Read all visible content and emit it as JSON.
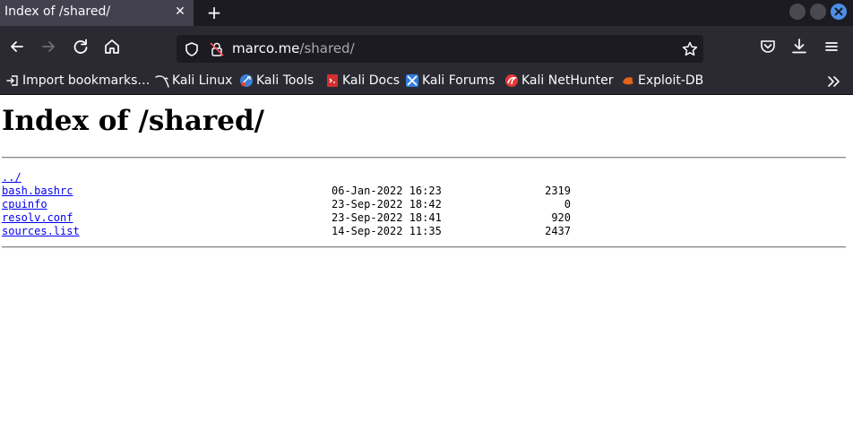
{
  "browser": {
    "tab_title": "Index of /shared/",
    "tab_close": "✕",
    "new_tab": "+",
    "url_host": "marco.me",
    "url_path": "/shared/"
  },
  "bookmarks": [
    {
      "label": "Import bookmarks…",
      "icon": "import-icon"
    },
    {
      "label": "Kali Linux",
      "icon": "kali-dragon-icon"
    },
    {
      "label": "Kali Tools",
      "icon": "kali-tools-icon"
    },
    {
      "label": "Kali Docs",
      "icon": "kali-docs-icon"
    },
    {
      "label": "Kali Forums",
      "icon": "kali-forums-icon"
    },
    {
      "label": "Kali NetHunter",
      "icon": "kali-nethunter-icon"
    },
    {
      "label": "Exploit-DB",
      "icon": "exploit-db-icon"
    }
  ],
  "page": {
    "title": "Index of /shared/",
    "parent_link": "../",
    "files": [
      {
        "name": "bash.bashrc",
        "date": "06-Jan-2022 16:23",
        "size": "2319"
      },
      {
        "name": "cpuinfo",
        "date": "23-Sep-2022 18:42",
        "size": "0"
      },
      {
        "name": "resolv.conf",
        "date": "23-Sep-2022 18:41",
        "size": "920"
      },
      {
        "name": "sources.list",
        "date": "14-Sep-2022 11:35",
        "size": "2437"
      }
    ]
  },
  "colors": {
    "chrome_dark": "#1c1b22",
    "toolbar": "#2b2a33",
    "active_tab": "#42414d",
    "link": "#0000ee",
    "close_button": "#4d8ee8"
  }
}
